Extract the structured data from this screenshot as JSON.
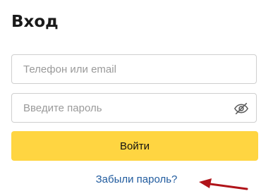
{
  "login": {
    "title": "Вход",
    "login_field": {
      "placeholder": "Телефон или email",
      "value": ""
    },
    "password_field": {
      "placeholder": "Введите пароль",
      "value": ""
    },
    "submit_label": "Войти",
    "forgot_link": "Забыли пароль?"
  },
  "icons": {
    "password_toggle": "eye-off-icon",
    "annotation": "arrow-left-icon"
  },
  "colors": {
    "primary_button": "#ffd541",
    "link": "#205b9e",
    "annotation_arrow": "#b01319"
  }
}
